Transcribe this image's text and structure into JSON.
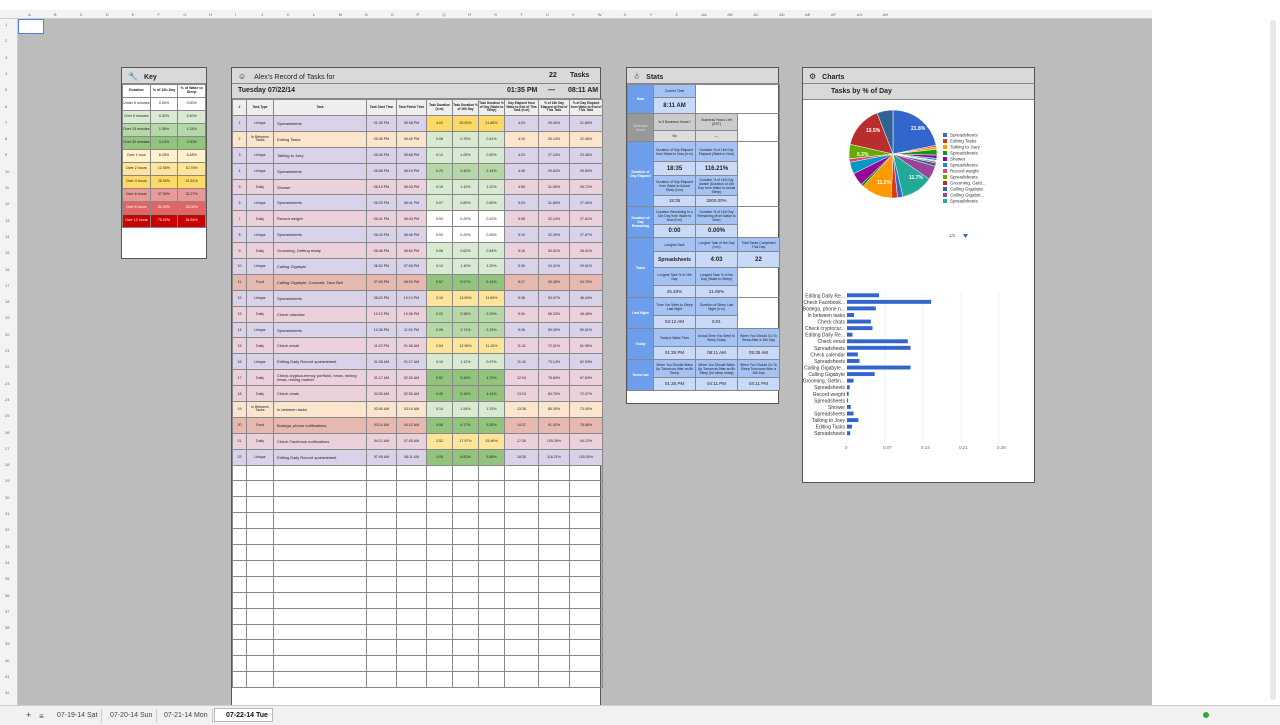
{
  "columns": [
    "A",
    "B",
    "C",
    "D",
    "E",
    "F",
    "G",
    "H",
    "I",
    "J",
    "K",
    "L",
    "M",
    "N",
    "O",
    "P",
    "Q",
    "R",
    "S",
    "T",
    "U",
    "V",
    "W",
    "X",
    "Y",
    "Z",
    "AA",
    "AB",
    "AC",
    "AD",
    "AE",
    "AF",
    "AG",
    "AH"
  ],
  "rows": [
    "1",
    "2",
    "3",
    "4",
    "5",
    "6",
    "7",
    "8",
    "9",
    "10",
    "11",
    "12",
    "13",
    "14",
    "15",
    "16",
    "17",
    "18",
    "19",
    "20",
    "21",
    "22",
    "23",
    "24",
    "25",
    "26",
    "27",
    "28",
    "29",
    "30",
    "31",
    "32",
    "33",
    "34",
    "35",
    "36",
    "37",
    "38",
    "39",
    "40",
    "41",
    "42"
  ],
  "sheet_tabs": [
    "07-19-14 Sat",
    "07-20-14 Sun",
    "07-21-14 Mon",
    "07-22-14 Tue"
  ],
  "key": {
    "title": "Key",
    "headers": [
      "Duration",
      "% of 16h Day",
      "% of Wake to Sleep"
    ],
    "rows": [
      {
        "duration": "Under 5 minutes",
        "day": "0.00%",
        "wake": "0.00%",
        "color": "#ffffff"
      },
      {
        "duration": "Over 5 minutes",
        "day": "0.52%",
        "wake": "0.40%",
        "color": "#d9ead3"
      },
      {
        "duration": "Over 15 minutes",
        "day": "1.56%",
        "wake": "1.24%",
        "color": "#b6d7a8"
      },
      {
        "duration": "Over 30 minutes",
        "day": "3.13%",
        "wake": "2.90%",
        "color": "#93c47d"
      },
      {
        "duration": "Over 1 hour",
        "day": "6.25%",
        "wake": "5.48%",
        "color": "#fff2cc"
      },
      {
        "duration": "Over 2 hours",
        "day": "12.50%",
        "wake": "10.76%",
        "color": "#ffe599"
      },
      {
        "duration": "Over 4 hours",
        "day": "25.00%",
        "wake": "21.51%",
        "color": "#ffd966"
      },
      {
        "duration": "Over 6 hours",
        "day": "37.50%",
        "wake": "32.27%",
        "color": "#ea9999"
      },
      {
        "duration": "Over 8 hours",
        "day": "50.00%",
        "wake": "43.02%",
        "color": "#e06666"
      },
      {
        "duration": "Over 12 hours",
        "day": "75.00%",
        "wake": "64.54%",
        "color": "#cc0000"
      }
    ]
  },
  "tasks": {
    "title": "Alex's Record of Tasks for",
    "count": "22",
    "count_label": "Tasks",
    "date": "Tuesday 07/22/14",
    "time_range_start": "01:35 PM",
    "dash": "—",
    "time_range_end": "08:11 AM",
    "headers": [
      "#",
      "Task Type",
      "Task",
      "Task Start Time",
      "Task Finish Time",
      "Task Duration (h:m)",
      "Task Duration % of 16h Day",
      "Task Duration % of Day (Wake to Sleep)",
      "Day Elapsed from Wake to End of This Task (h:m)",
      "% of 16h Day Elapsed at End of This Task",
      "% of Day Elapsed from Wake to End of This Task"
    ],
    "rows": [
      {
        "n": "1",
        "type": "Unique",
        "task": "Spreadsheets",
        "start": "01:35 PM",
        "end": "05:38 PM",
        "dur": "4:03",
        "pday": "25.00%",
        "pwake": "21.85%",
        "el": "4:03",
        "pel": "25.40%",
        "pwel": "21.85%",
        "bg": "#d9d2e9",
        "dc": "#ffd966"
      },
      {
        "n": "2",
        "type": "In Between Tasks",
        "task": "Editing Tasks",
        "start": "05:38 PM",
        "end": "05:45 PM",
        "dur": "0:08",
        "pday": "0.75%",
        "pwake": "0.61%",
        "el": "4:10",
        "pel": "26.10%",
        "pwel": "22.46%",
        "bg": "#fce5cd",
        "dc": "#d9ead3"
      },
      {
        "n": "3",
        "type": "Unique",
        "task": "Talking to Joey",
        "start": "05:45 PM",
        "end": "05:58 PM",
        "dur": "0:13",
        "pday": "1.05%",
        "pwake": "0.90%",
        "el": "4:23",
        "pel": "27.15%",
        "pwel": "23.36%",
        "bg": "#d9d2e9",
        "dc": "#d9ead3"
      },
      {
        "n": "4",
        "type": "Unique",
        "task": "Spreadsheets",
        "start": "05:58 PM",
        "end": "06:19 PM",
        "dur": "0:23",
        "pday": "2.40%",
        "pwake": "2.14%",
        "el": "4:46",
        "pel": "29.63%",
        "pwel": "25.50%",
        "bg": "#d9d2e9",
        "dc": "#b6d7a8"
      },
      {
        "n": "5",
        "type": "Daily",
        "task": "Shower",
        "start": "06:19 PM",
        "end": "06:33 PM",
        "dur": "0:15",
        "pday": "1.42%",
        "pwake": "1.22%",
        "el": "4:55",
        "pel": "31.05%",
        "pwel": "26.72%",
        "bg": "#ead1dc",
        "dc": "#d9ead3"
      },
      {
        "n": "6",
        "type": "Unique",
        "task": "Spreadsheets",
        "start": "06:33 PM",
        "end": "06:41 PM",
        "dur": "0:07",
        "pday": "0.80%",
        "pwake": "0.69%",
        "el": "5:03",
        "pel": "31.85%",
        "pwel": "27.40%",
        "bg": "#d9d2e9",
        "dc": "#d9ead3"
      },
      {
        "n": "7",
        "type": "Daily",
        "task": "Record weight",
        "start": "06:41 PM",
        "end": "06:43 PM",
        "dur": "0:02",
        "pday": "0.25%",
        "pwake": "0.22%",
        "el": "5:08",
        "pel": "32.10%",
        "pwel": "27.62%",
        "bg": "#ead1dc",
        "dc": "#ffffff"
      },
      {
        "n": "8",
        "type": "Unique",
        "task": "Spreadsheets",
        "start": "06:43 PM",
        "end": "06:46 PM",
        "dur": "0:02",
        "pday": "0.29%",
        "pwake": "0.25%",
        "el": "5:10",
        "pel": "32.39%",
        "pwel": "27.87%",
        "bg": "#d9d2e9",
        "dc": "#ffffff"
      },
      {
        "n": "9",
        "type": "Daily",
        "task": "Grooming, Getting ready",
        "start": "06:46 PM",
        "end": "06:52 PM",
        "dur": "0:06",
        "pday": "0.62%",
        "pwake": "0.54%",
        "el": "5:16",
        "pel": "33.02%",
        "pwel": "28.41%",
        "bg": "#ead1dc",
        "dc": "#d9ead3"
      },
      {
        "n": "10",
        "type": "Unique",
        "task": "Calling Gigabyte",
        "start": "06:52 PM",
        "end": "07:05 PM",
        "dur": "0:13",
        "pday": "1.40%",
        "pwake": "1.20%",
        "el": "5:30",
        "pel": "34.41%",
        "pwel": "29.61%",
        "bg": "#d9d2e9",
        "dc": "#d9ead3"
      },
      {
        "n": "11",
        "type": "Food",
        "task": "Calling Gigabyte, Comcast, Taco Bell",
        "start": "07:05 PM",
        "end": "08:03 PM",
        "dur": "0:57",
        "pday": "5.97%",
        "pwake": "5.14%",
        "el": "6:27",
        "pel": "40.38%",
        "pwel": "34.75%",
        "bg": "#e6b8af",
        "dc": "#93c47d"
      },
      {
        "n": "12",
        "type": "Unique",
        "task": "Spreadsheets",
        "start": "08:03 PM",
        "end": "10:13 PM",
        "dur": "2:10",
        "pday": "13.59%",
        "pwake": "11.69%",
        "el": "8:38",
        "pel": "53.97%",
        "pwel": "46.44%",
        "bg": "#d9d2e9",
        "dc": "#ffe599"
      },
      {
        "n": "13",
        "type": "Daily",
        "task": "Check calendar",
        "start": "10:13 PM",
        "end": "10:36 PM",
        "dur": "0:22",
        "pday": "2.36%",
        "pwake": "2.03%",
        "el": "9:00",
        "pel": "56.33%",
        "pwel": "48.48%",
        "bg": "#ead1dc",
        "dc": "#b6d7a8"
      },
      {
        "n": "14",
        "type": "Unique",
        "task": "Spreadsheets",
        "start": "10:36 PM",
        "end": "11:02 PM",
        "dur": "0:26",
        "pday": "2.71%",
        "pwake": "2.33%",
        "el": "9:26",
        "pel": "59.05%",
        "pwel": "50.81%",
        "bg": "#d9d2e9",
        "dc": "#b6d7a8"
      },
      {
        "n": "15",
        "type": "Daily",
        "task": "Check email",
        "start": "11:02 PM",
        "end": "01:06 AM",
        "dur": "2:04",
        "pday": "12.96%",
        "pwake": "11.15%",
        "el": "11:31",
        "pel": "72.01%",
        "pwel": "61.96%",
        "bg": "#ead1dc",
        "dc": "#ffe599"
      },
      {
        "n": "16",
        "type": "Unique",
        "task": "Editing Daily Record spreadsheet",
        "start": "01:06 AM",
        "end": "01:17 AM",
        "dur": "0:10",
        "pday": "1.12%",
        "pwake": "0.97%",
        "el": "11:42",
        "pel": "73.14%",
        "pwel": "62.93%",
        "bg": "#d9d2e9",
        "dc": "#d9ead3"
      },
      {
        "n": "17",
        "type": "Daily",
        "task": "Check cryptocurrency portfolio, news, mining news, mining market",
        "start": "01:17 AM",
        "end": "02:00 AM",
        "dur": "0:52",
        "pday": "5.46%",
        "pwake": "4.70%",
        "el": "12:34",
        "pel": "78.60%",
        "pwel": "67.63%",
        "bg": "#ead1dc",
        "dc": "#93c47d"
      },
      {
        "n": "18",
        "type": "Daily",
        "task": "Check chats",
        "start": "02:00 AM",
        "end": "02:50 AM",
        "dur": "0:49",
        "pday": "5.16%",
        "pwake": "4.44%",
        "el": "13:24",
        "pel": "83.76%",
        "pwel": "72.07%",
        "bg": "#ead1dc",
        "dc": "#93c47d"
      },
      {
        "n": "19",
        "type": "In Between Tasks",
        "task": "In between tasks",
        "start": "02:50 AM",
        "end": "03:14 AM",
        "dur": "0:14",
        "pday": "1.54%",
        "pwake": "1.33%",
        "el": "13:38",
        "pel": "85.30%",
        "pwel": "73.40%",
        "bg": "#fce5cd",
        "dc": "#d9ead3"
      },
      {
        "n": "20",
        "type": "Food",
        "task": "Bodega, phone notifications",
        "start": "03:14 AM",
        "end": "04:12 AM",
        "dur": "0:58",
        "pday": "6.17%",
        "pwake": "5.26%",
        "el": "14:37",
        "pel": "91.42%",
        "pwel": "78.66%",
        "bg": "#e6b8af",
        "dc": "#93c47d"
      },
      {
        "n": "21",
        "type": "Daily",
        "task": "Check Facebook notifications",
        "start": "04:12 AM",
        "end": "07:05 AM",
        "dur": "2:52",
        "pday": "17.97%",
        "pwake": "15.46%",
        "el": "17:30",
        "pel": "109.39%",
        "pwel": "94.12%",
        "bg": "#ead1dc",
        "dc": "#ffe599"
      },
      {
        "n": "22",
        "type": "Unique",
        "task": "Editing Daily Record spreadsheet",
        "start": "07:05 AM",
        "end": "08:11 AM",
        "dur": "1:05",
        "pday": "6.82%",
        "pwake": "5.88%",
        "el": "18:35",
        "pel": "116.21%",
        "pwel": "100.00%",
        "bg": "#d9d2e9",
        "dc": "#93c47d"
      }
    ]
  },
  "stats": {
    "title": "Stats",
    "now_label": "Now",
    "current_time_label": "Current Time",
    "current_time": "8:11 AM",
    "business_hours_label": "Business Hours",
    "is_it_business_hours": "Is It Business Hours?",
    "business_hours_left": "Business Hours Left (EST)",
    "time_until_business": "Time Until Business Hours Resume (EST)",
    "business_no": "No",
    "business_dash": "—",
    "duration_elapsed_label": "Duration of Day Elapsed",
    "dur_wake_sleep_label": "Duration of Day Elapsed from Wake to Now (h:m)",
    "pct_16h_elapsed_label": "Duration % of 16h Day Elapsed (Wake to Now)",
    "dur_wake_sleep": "18:35",
    "pct_16h": "116.21%",
    "dur_actual_label": "Duration of Day Elapsed from Wake to Actual Sleep (h:m)",
    "pct_actual_label": "Duration % of 16h Day Awake (Duration of 16h Day from Wake to Actual Sleep)",
    "dur_actual": "18:35",
    "pct_actual": "2000.00%",
    "remaining_label": "Duration of Day Remaining",
    "rem_dur_label": "Duration Remaining in a 16h Day from Wake to Now (h:m)",
    "rem_pct_label": "Duration % of 16h Day Remaining (from Wake to Now)",
    "rem_dur": "0:00",
    "rem_pct": "0.00%",
    "tasks_label": "Tasks",
    "longest_task_label": "Longest Task",
    "longest_time_label": "Longest Task of the Day (h:m)",
    "total_tasks_label": "Total Tasks Completed This Day",
    "longest_task": "Spreadsheets",
    "longest_time": "4:03",
    "total_tasks": "22",
    "longest_pct16_label": "Longest Task % of 16h Day",
    "longest_pctwake_label": "Longest Task % of the Day (Wake to Sleep)",
    "longest_pct16": "25.40%",
    "longest_pctwake": "21.85%",
    "last_night_label": "Last Night",
    "time_went_bed_label": "Time You Went to Sleep Last Night",
    "dur_sleep_label": "Duration of Sleep Last Night (h:m)",
    "time_went_bed": "04:12 AM",
    "dur_sleep": "6:01",
    "today_label": "Today",
    "wake_time_label": "Today's Wake Time",
    "actual_wake_label": "Actual Time You Went to Sleep Today",
    "should_sleep_label": "When You Should Go To Sleep After a 16h Day",
    "wake_time": "01:35 PM",
    "actual_sleep": "08:11 AM",
    "should_sleep": "05:35 AM",
    "tomorrow_label": "Tomorrow",
    "tm1_label": "When You Should Wake Up Tomorrow After an 8h Sleep",
    "tm2_label": "When You Should Wake Up Tomorrow After an 8h Sleep (for sleep today)",
    "tm3_label": "When You Should Go To Sleep Tomorrow After a 16h Day",
    "tm1": "01:35 PM",
    "tm2": "04:11 PM",
    "tm3": "04:11 PM"
  },
  "charts": {
    "title": "Charts",
    "subtitle": "Tasks by % of Day",
    "pager": "1/2",
    "pie_labels": [
      "21.8%",
      "15.5%",
      "11.7%",
      "11.2%",
      "6.3%"
    ]
  },
  "colors": {
    "accent": "#3366cc",
    "grid_bg": "#bcbcbc",
    "section_blue": "#6d9eeb"
  },
  "chart_data": [
    {
      "type": "pie",
      "title": "Tasks by % of Day",
      "legend_position": "right",
      "categories": [
        "Spreadsheets",
        "Editing Tasks",
        "Talking to Joey",
        "Spreadsheets",
        "Shower",
        "Spreadsheets",
        "Record weight",
        "Spreadsheets",
        "Grooming, Getti...",
        "Calling Gigabyte",
        "Calling Gigabyt...",
        "Spreadsheets"
      ],
      "colors": [
        "#3366cc",
        "#dc3912",
        "#ff9900",
        "#109618",
        "#990099",
        "#0099c6",
        "#dd4477",
        "#66aa00",
        "#b82e2e",
        "#316395",
        "#994499",
        "#22aa99"
      ],
      "values": [
        21.8,
        0.6,
        0.9,
        2.1,
        1.2,
        0.7,
        0.2,
        0.3,
        0.5,
        1.2,
        5.1,
        11.7,
        2.0,
        2.3,
        11.2,
        1.0,
        4.7,
        4.4,
        1.3,
        5.3,
        15.5,
        5.9
      ]
    },
    {
      "type": "bar",
      "orientation": "horizontal",
      "categories": [
        "Editing Daily Re...",
        "Check Facebook...",
        "Bodega, phone n...",
        "In between tasks",
        "Check chats",
        "Check cryptocur...",
        "Editing Daily Re...",
        "Check email",
        "Spreadsheets",
        "Check calendar",
        "Spreadsheets",
        "Calling Gigabyte...",
        "Calling Gigabyte",
        "Grooming, Gettin...",
        "Spreadsheets",
        "Record weight",
        "Spreadsheets",
        "Shower",
        "Spreadsheets",
        "Talking to Joey",
        "Editing Tasks",
        "Spreadsheets"
      ],
      "values": [
        0.059,
        0.155,
        0.053,
        0.013,
        0.044,
        0.047,
        0.01,
        0.112,
        0.117,
        0.02,
        0.023,
        0.117,
        0.051,
        0.012,
        0.005,
        0.003,
        0.002,
        0.007,
        0.012,
        0.021,
        0.009,
        0.006,
        0.218
      ],
      "xlim": [
        0,
        0.28
      ],
      "xticks": [
        "0",
        "0.07",
        "0.14",
        "0.21",
        "0.28"
      ]
    }
  ]
}
